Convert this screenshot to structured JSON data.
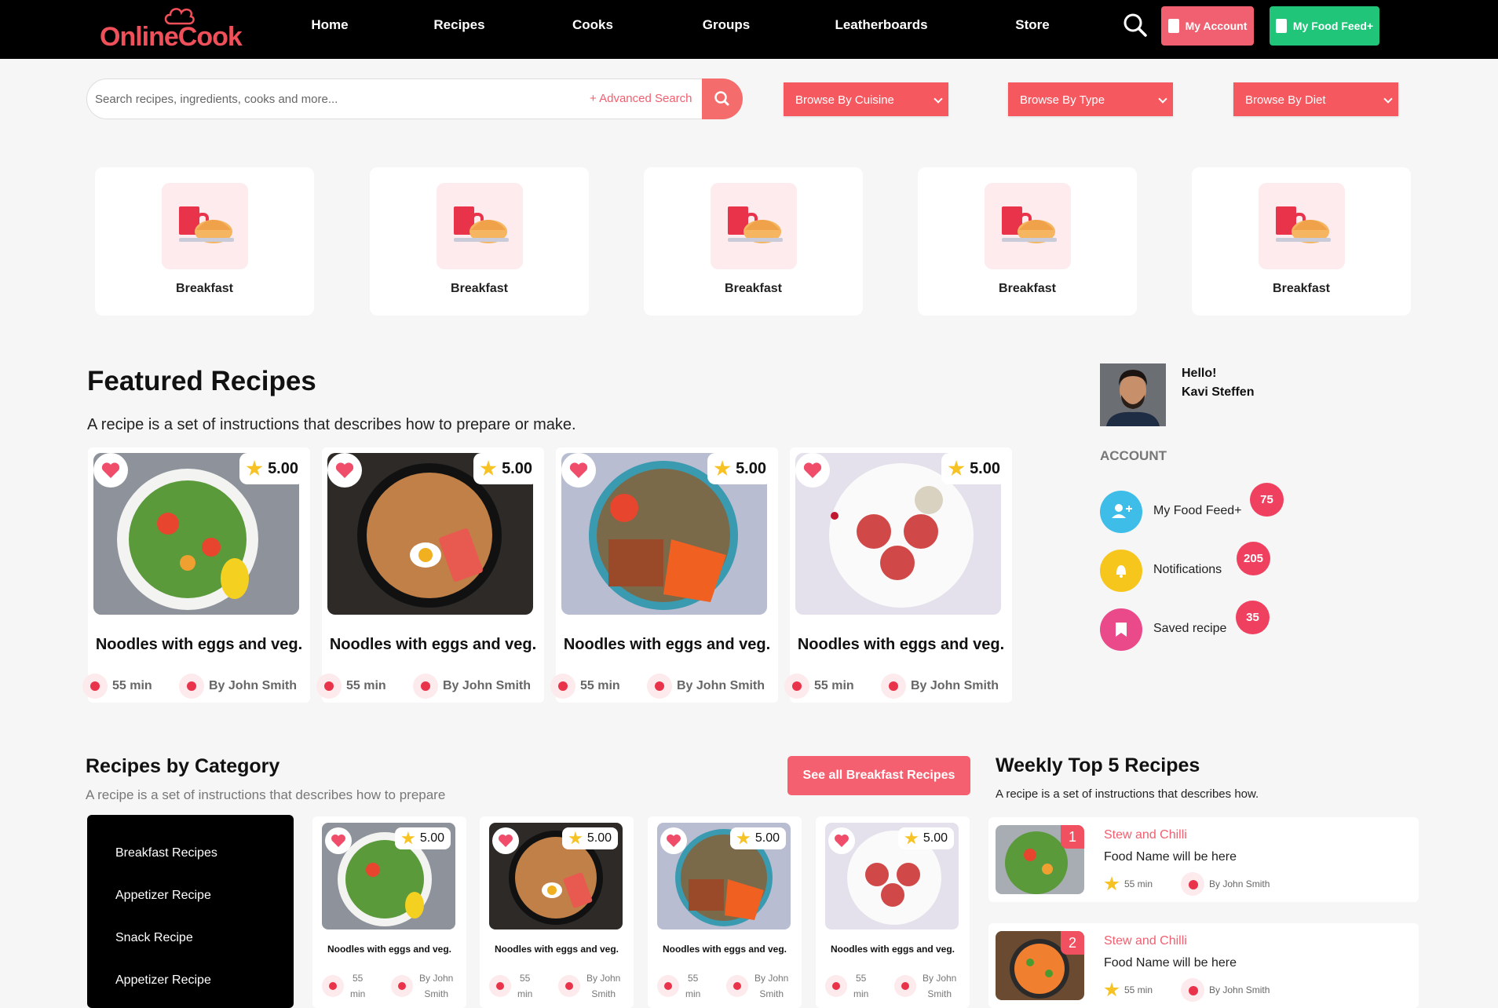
{
  "brand": {
    "part1": "Online",
    "part2": "Cook"
  },
  "nav": [
    "Home",
    "Recipes",
    "Cooks",
    "Groups",
    "Leatherboards",
    "Store"
  ],
  "header_buttons": {
    "account": "My Account",
    "feed": "My Food Feed+"
  },
  "search": {
    "placeholder": "Search recipes, ingredients, cooks and more...",
    "advanced": "+ Advanced Search"
  },
  "browse": [
    "Browse By Cuisine",
    "Browse By Type",
    "Browse By Diet"
  ],
  "categories": [
    "Breakfast",
    "Breakfast",
    "Breakfast",
    "Breakfast",
    "Breakfast"
  ],
  "featured": {
    "title": "Featured Recipes",
    "description": "A recipe is a set of instructions that describes how to prepare or make.",
    "cards": [
      {
        "rating": "5.00",
        "title": "Noodles with eggs and veg.",
        "time": "55 min",
        "author": "By John Smith"
      },
      {
        "rating": "5.00",
        "title": "Noodles with eggs and veg.",
        "time": "55 min",
        "author": "By John Smith"
      },
      {
        "rating": "5.00",
        "title": "Noodles with eggs and veg.",
        "time": "55 min",
        "author": "By John Smith"
      },
      {
        "rating": "5.00",
        "title": "Noodles with eggs and veg.",
        "time": "55 min",
        "author": "By John Smith"
      }
    ]
  },
  "profile": {
    "greeting": "Hello!",
    "name": "Kavi Steffen",
    "account_label": "ACCOUNT"
  },
  "account_items": [
    {
      "label": "My Food Feed+",
      "count": "75",
      "color": "#3dbde8"
    },
    {
      "label": "Notifications",
      "count": "205",
      "color": "#f7c61c"
    },
    {
      "label": "Saved recipe",
      "count": "35",
      "color": "#ea4a8a"
    }
  ],
  "recipes_by_category": {
    "title": "Recipes by Category",
    "description": "A recipe is a set of instructions that describes how to prepare",
    "see_all": "See all Breakfast Recipes",
    "list": [
      "Breakfast Recipes",
      "Appetizer Recipe",
      "Snack Recipe",
      "Appetizer Recipe"
    ],
    "cards": [
      {
        "rating": "5.00",
        "title": "Noodles with eggs and veg.",
        "time_num": "55",
        "time_unit": "min",
        "author1": "By John",
        "author2": "Smith"
      },
      {
        "rating": "5.00",
        "title": "Noodles with eggs and veg.",
        "time_num": "55",
        "time_unit": "min",
        "author1": "By John",
        "author2": "Smith"
      },
      {
        "rating": "5.00",
        "title": "Noodles with eggs and veg.",
        "time_num": "55",
        "time_unit": "min",
        "author1": "By John",
        "author2": "Smith"
      },
      {
        "rating": "5.00",
        "title": "Noodles with eggs and veg.",
        "time_num": "55",
        "time_unit": "min",
        "author1": "By John",
        "author2": "Smith"
      }
    ]
  },
  "weekly": {
    "title": "Weekly Top 5 Recipes",
    "description": "A recipe is a set of instructions that describes how.",
    "items": [
      {
        "rank": "1",
        "category": "Stew and Chilli",
        "name": "Food Name will be here",
        "time": "55 min",
        "author": "By John Smith"
      },
      {
        "rank": "2",
        "category": "Stew and Chilli",
        "name": "Food Name will be here",
        "time": "55 min",
        "author": "By John Smith"
      }
    ]
  },
  "colors": {
    "accent": "#f5585f",
    "topbar": "#000000",
    "feed_button": "#20c57a"
  }
}
